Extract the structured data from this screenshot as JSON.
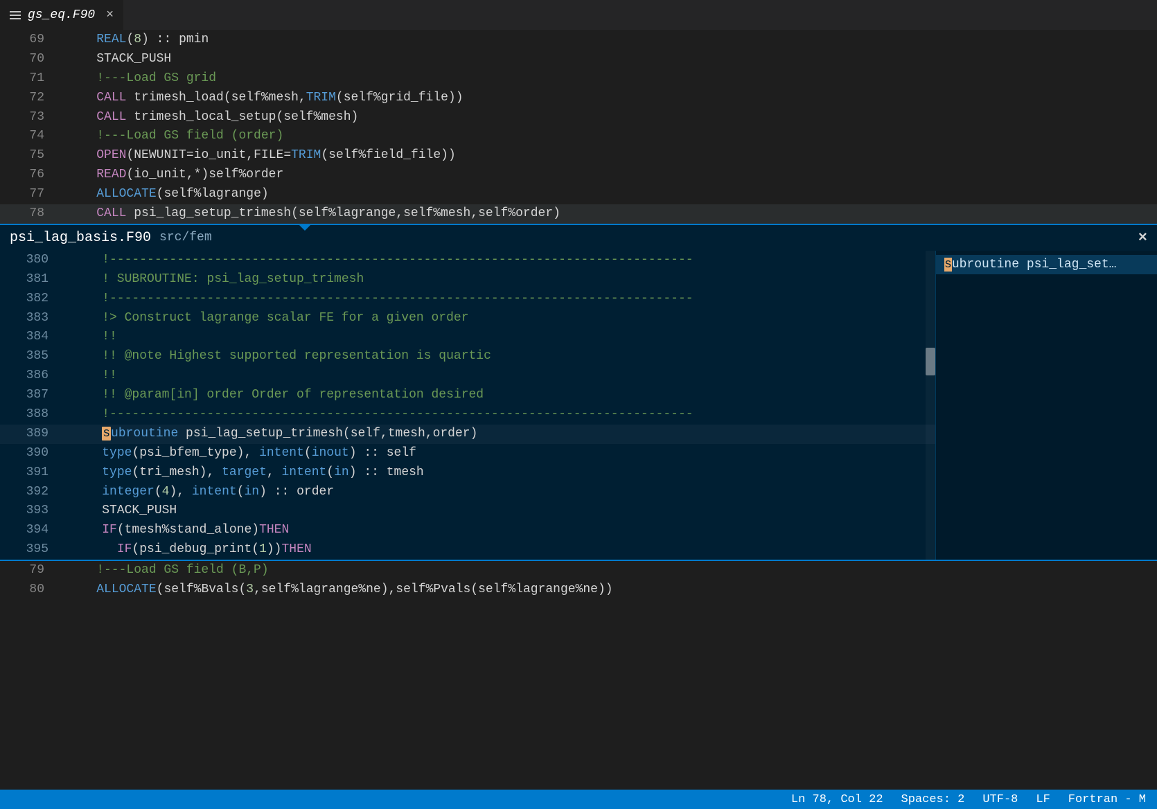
{
  "tab": {
    "filename": "gs_eq.F90",
    "close_glyph": "×"
  },
  "editor_top": [
    {
      "n": 69,
      "segs": [
        [
          "    ",
          "ident"
        ],
        [
          "REAL",
          "type"
        ],
        [
          "(",
          "pun"
        ],
        [
          "8",
          "num"
        ],
        [
          ") :: pmin",
          "ident"
        ]
      ]
    },
    {
      "n": 70,
      "segs": [
        [
          "    STACK_PUSH",
          "ident"
        ]
      ]
    },
    {
      "n": 71,
      "segs": [
        [
          "    !---Load GS grid",
          "cmt"
        ]
      ]
    },
    {
      "n": 72,
      "segs": [
        [
          "    ",
          "ident"
        ],
        [
          "CALL",
          "kw"
        ],
        [
          " trimesh_load(self%mesh,",
          "ident"
        ],
        [
          "TRIM",
          "type"
        ],
        [
          "(self%grid_file))",
          "ident"
        ]
      ]
    },
    {
      "n": 73,
      "segs": [
        [
          "    ",
          "ident"
        ],
        [
          "CALL",
          "kw"
        ],
        [
          " trimesh_local_setup(self%mesh)",
          "ident"
        ]
      ]
    },
    {
      "n": 74,
      "segs": [
        [
          "    !---Load GS field (order)",
          "cmt"
        ]
      ]
    },
    {
      "n": 75,
      "segs": [
        [
          "    ",
          "ident"
        ],
        [
          "OPEN",
          "kw"
        ],
        [
          "(",
          "pun"
        ],
        [
          "NEWUNIT",
          "ident"
        ],
        [
          "=io_unit,",
          "ident"
        ],
        [
          "FILE",
          "ident"
        ],
        [
          "=",
          "op"
        ],
        [
          "TRIM",
          "type"
        ],
        [
          "(self%field_file))",
          "ident"
        ]
      ]
    },
    {
      "n": 76,
      "segs": [
        [
          "    ",
          "ident"
        ],
        [
          "READ",
          "kw"
        ],
        [
          "(io_unit,*)self%order",
          "ident"
        ]
      ]
    },
    {
      "n": 77,
      "segs": [
        [
          "    ",
          "ident"
        ],
        [
          "ALLOCATE",
          "type"
        ],
        [
          "(self%lagrange)",
          "ident"
        ]
      ]
    },
    {
      "n": 78,
      "current": true,
      "segs": [
        [
          "    ",
          "ident"
        ],
        [
          "CALL",
          "kw"
        ],
        [
          " psi_lag_setup_trimesh(self%lagrange,self%mesh,self%order)",
          "ident"
        ]
      ]
    }
  ],
  "peek": {
    "filename": "psi_lag_basis.F90",
    "path": "src/fem",
    "close_glyph": "×",
    "ref_text_prefix": "s",
    "ref_text_rest": "ubroutine psi_lag_set…",
    "lines": [
      {
        "n": 380,
        "segs": [
          [
            "    !------------------------------------------------------------------------------",
            "cmt"
          ]
        ]
      },
      {
        "n": 381,
        "segs": [
          [
            "    ! SUBROUTINE: psi_lag_setup_trimesh",
            "cmt"
          ]
        ]
      },
      {
        "n": 382,
        "segs": [
          [
            "    !------------------------------------------------------------------------------",
            "cmt"
          ]
        ]
      },
      {
        "n": 383,
        "segs": [
          [
            "    !> Construct lagrange scalar FE for a given order",
            "cmt"
          ]
        ]
      },
      {
        "n": 384,
        "segs": [
          [
            "    !!",
            "cmt"
          ]
        ]
      },
      {
        "n": 385,
        "segs": [
          [
            "    !! @note Highest supported representation is quartic",
            "cmt"
          ]
        ]
      },
      {
        "n": 386,
        "segs": [
          [
            "    !!",
            "cmt"
          ]
        ]
      },
      {
        "n": 387,
        "segs": [
          [
            "    !! @param[in] order Order of representation desired",
            "cmt"
          ]
        ]
      },
      {
        "n": 388,
        "segs": [
          [
            "    !------------------------------------------------------------------------------",
            "cmt"
          ]
        ]
      },
      {
        "n": 389,
        "hl": true,
        "segs": [
          [
            "    ",
            "ident"
          ],
          [
            "s",
            "hlchar"
          ],
          [
            "ubroutine",
            "type"
          ],
          [
            " psi_lag_setup_trimesh(",
            "ident"
          ],
          [
            "self",
            "ident"
          ],
          [
            ",",
            "pun"
          ],
          [
            "tmesh",
            "ident"
          ],
          [
            ",",
            "pun"
          ],
          [
            "order",
            "ident"
          ],
          [
            ")",
            "pun"
          ]
        ]
      },
      {
        "n": 390,
        "segs": [
          [
            "    ",
            "ident"
          ],
          [
            "type",
            "type"
          ],
          [
            "(psi_bfem_type), ",
            "ident"
          ],
          [
            "intent",
            "type"
          ],
          [
            "(",
            "pun"
          ],
          [
            "inout",
            "type"
          ],
          [
            ") :: self",
            "ident"
          ]
        ]
      },
      {
        "n": 391,
        "segs": [
          [
            "    ",
            "ident"
          ],
          [
            "type",
            "type"
          ],
          [
            "(tri_mesh), ",
            "ident"
          ],
          [
            "target",
            "type"
          ],
          [
            ", ",
            "ident"
          ],
          [
            "intent",
            "type"
          ],
          [
            "(",
            "pun"
          ],
          [
            "in",
            "type"
          ],
          [
            ") :: tmesh",
            "ident"
          ]
        ]
      },
      {
        "n": 392,
        "segs": [
          [
            "    ",
            "ident"
          ],
          [
            "integer",
            "type"
          ],
          [
            "(",
            "pun"
          ],
          [
            "4",
            "num"
          ],
          [
            "), ",
            "ident"
          ],
          [
            "intent",
            "type"
          ],
          [
            "(",
            "pun"
          ],
          [
            "in",
            "type"
          ],
          [
            ") :: order",
            "ident"
          ]
        ]
      },
      {
        "n": 393,
        "segs": [
          [
            "    STACK_PUSH",
            "ident"
          ]
        ]
      },
      {
        "n": 394,
        "segs": [
          [
            "    ",
            "ident"
          ],
          [
            "IF",
            "kw"
          ],
          [
            "(tmesh%stand_alone)",
            "ident"
          ],
          [
            "THEN",
            "kw"
          ]
        ]
      },
      {
        "n": 395,
        "segs": [
          [
            "      ",
            "ident"
          ],
          [
            "IF",
            "kw"
          ],
          [
            "(psi_debug_print(",
            "ident"
          ],
          [
            "1",
            "num"
          ],
          [
            "))",
            "ident"
          ],
          [
            "THEN",
            "kw"
          ]
        ]
      }
    ]
  },
  "editor_bottom": [
    {
      "n": 79,
      "segs": [
        [
          "    !---Load GS field (B,P)",
          "cmt"
        ]
      ]
    },
    {
      "n": 80,
      "segs": [
        [
          "    ",
          "ident"
        ],
        [
          "ALLOCATE",
          "type"
        ],
        [
          "(self%Bvals(",
          "ident"
        ],
        [
          "3",
          "num"
        ],
        [
          ",self%lagrange%ne),self%Pvals(self%lagrange%ne))",
          "ident"
        ]
      ]
    }
  ],
  "statusbar": {
    "position": "Ln 78, Col 22",
    "spaces": "Spaces: 2",
    "encoding": "UTF-8",
    "eol": "LF",
    "language": "Fortran - M"
  },
  "colors": {
    "accent": "#007acc"
  }
}
